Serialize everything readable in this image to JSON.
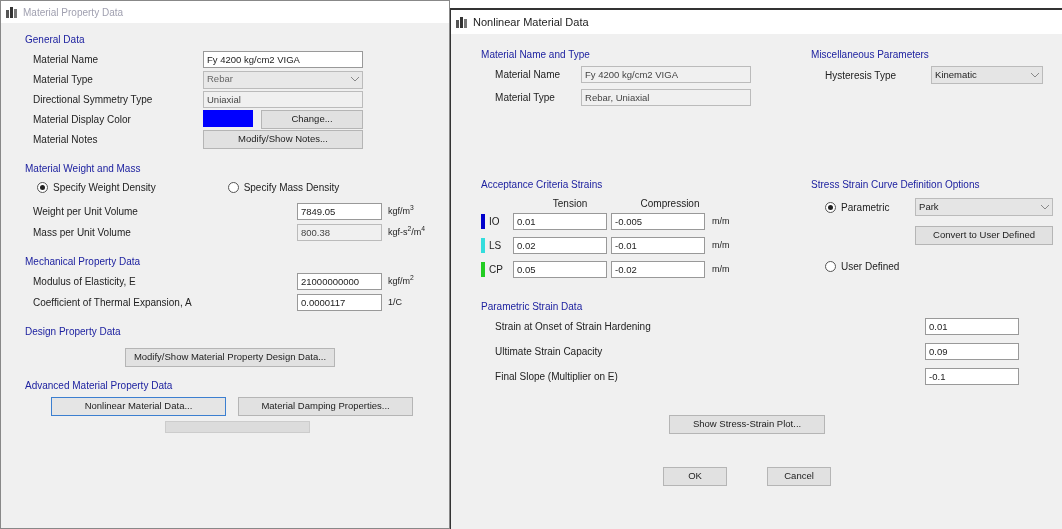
{
  "left_window": {
    "title": "Material Property Data",
    "active": false,
    "general": {
      "heading": "General Data",
      "rows": [
        {
          "label": "Material Name",
          "kind": "text",
          "value": "Fy 4200 kg/cm2 VIGA"
        },
        {
          "label": "Material Type",
          "kind": "dropdown",
          "value": "Rebar",
          "disabled": true
        },
        {
          "label": "Directional Symmetry Type",
          "kind": "readonly",
          "value": "Uniaxial"
        },
        {
          "label": "Material Display Color",
          "kind": "color",
          "color": "#0000ff",
          "button": "Change..."
        },
        {
          "label": "Material Notes",
          "kind": "button",
          "button": "Modify/Show Notes..."
        }
      ]
    },
    "weight": {
      "heading": "Material Weight and Mass",
      "radios": [
        {
          "label": "Specify Weight Density",
          "selected": true
        },
        {
          "label": "Specify Mass Density",
          "selected": false
        }
      ],
      "rows": [
        {
          "label": "Weight per Unit Volume",
          "value": "7849.05",
          "unit": "kgf/m$^{3}$",
          "disabled": false
        },
        {
          "label": "Mass per Unit Volume",
          "value": "800.38",
          "unit": "kgf-s$^{2}$/m$^{4}$",
          "disabled": true
        }
      ]
    },
    "mechanical": {
      "heading": "Mechanical Property Data",
      "rows": [
        {
          "label": "Modulus of Elasticity,  E",
          "value": "21000000000",
          "unit": "kgf/m$^{2}$",
          "disabled": false
        },
        {
          "label": "Coefficient of Thermal Expansion,  A",
          "value": "0.0000117",
          "unit": "1/C",
          "disabled": false
        }
      ]
    },
    "design": {
      "heading": "Design Property Data",
      "button": "Modify/Show Material Property Design Data..."
    },
    "advanced": {
      "heading": "Advanced Material Property Data",
      "buttons": [
        {
          "label": "Nonlinear Material Data...",
          "focused": true
        },
        {
          "label": "Material Damping Properties...",
          "focused": false
        }
      ]
    }
  },
  "right_window": {
    "title": "Nonlinear Material Data",
    "active": true,
    "name_type": {
      "heading": "Material Name and Type",
      "rows": [
        {
          "label": "Material Name",
          "value": "Fy 4200 kg/cm2 VIGA"
        },
        {
          "label": "Material Type",
          "value": "Rebar, Uniaxial"
        }
      ]
    },
    "misc": {
      "heading": "Miscellaneous Parameters",
      "label": "Hysteresis Type",
      "value": "Kinematic"
    },
    "acceptance": {
      "heading": "Acceptance Criteria Strains",
      "columns": [
        "Tension",
        "Compression"
      ],
      "rows": [
        {
          "name": "IO",
          "color": "#0000cc",
          "tension": "0.01",
          "compression": "-0.005",
          "unit": "m/m"
        },
        {
          "name": "LS",
          "color": "#33dddd",
          "tension": "0.02",
          "compression": "-0.01",
          "unit": "m/m"
        },
        {
          "name": "CP",
          "color": "#22cc22",
          "tension": "0.05",
          "compression": "-0.02",
          "unit": "m/m"
        }
      ]
    },
    "curve": {
      "heading": "Stress Strain Curve Definition Options",
      "options": [
        {
          "label": "Parametric",
          "selected": true,
          "value": "Park",
          "button": "Convert to User Defined"
        },
        {
          "label": "User Defined",
          "selected": false
        }
      ]
    },
    "parametric": {
      "heading": "Parametric Strain Data",
      "rows": [
        {
          "label": "Strain at Onset of Strain Hardening",
          "value": "0.01"
        },
        {
          "label": "Ultimate Strain Capacity",
          "value": "0.09"
        },
        {
          "label": "Final Slope (Multiplier on E)",
          "value": "-0.1"
        }
      ]
    },
    "plot_button": "Show Stress-Strain Plot...",
    "buttons": [
      "OK",
      "Cancel"
    ]
  }
}
